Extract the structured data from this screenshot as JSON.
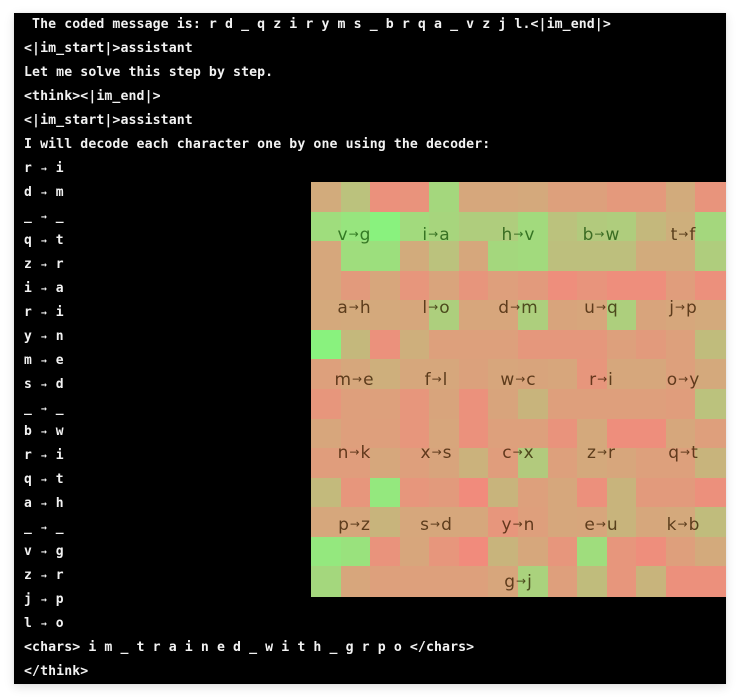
{
  "terminal": {
    "lines": [
      " The coded message is: r d _ q z i r y m s _ b r q a _ v z j l.<|im_end|>",
      "<|im_start|>assistant",
      "Let me solve this step by step.",
      "<think><|im_end|>",
      "<|im_start|>assistant",
      "I will decode each character one by one using the decoder:"
    ],
    "arrow_glyph": "→",
    "mappings": [
      {
        "from": "r",
        "to": "i"
      },
      {
        "from": "d",
        "to": "m"
      },
      {
        "from": "_",
        "to": "_"
      },
      {
        "from": "q",
        "to": "t"
      },
      {
        "from": "z",
        "to": "r"
      },
      {
        "from": "i",
        "to": "a"
      },
      {
        "from": "r",
        "to": "i"
      },
      {
        "from": "y",
        "to": "n"
      },
      {
        "from": "m",
        "to": "e"
      },
      {
        "from": "s",
        "to": "d"
      },
      {
        "from": "_",
        "to": "_"
      },
      {
        "from": "b",
        "to": "w"
      },
      {
        "from": "r",
        "to": "i"
      },
      {
        "from": "q",
        "to": "t"
      },
      {
        "from": "a",
        "to": "h"
      },
      {
        "from": "_",
        "to": "_"
      },
      {
        "from": "v",
        "to": "g"
      },
      {
        "from": "z",
        "to": "r"
      },
      {
        "from": "j",
        "to": "p"
      },
      {
        "from": "l",
        "to": "o"
      }
    ],
    "chars_line": "<chars> i m _ t r a i n e d _ w i t h _ g r p o </chars>",
    "end_line": "</think>"
  },
  "heatmap": {
    "description": "attention-style heatmap overlay, red (low) to green (high)",
    "colors": {
      "low": "#f28a7c",
      "mid": "#d2ab7c",
      "high": "#86f57e"
    },
    "grid": [
      [
        0.45,
        0.62,
        0.1,
        0.12,
        0.78,
        0.4,
        0.4,
        0.42,
        0.3,
        0.3,
        0.2,
        0.2,
        0.45,
        0.14
      ],
      [
        0.82,
        0.88,
        0.98,
        0.8,
        0.76,
        0.7,
        0.7,
        0.8,
        0.62,
        0.68,
        0.7,
        0.55,
        0.48,
        0.78
      ],
      [
        0.4,
        0.82,
        0.84,
        0.45,
        0.62,
        0.4,
        0.78,
        0.8,
        0.6,
        0.6,
        0.6,
        0.45,
        0.45,
        0.7
      ],
      [
        0.4,
        0.22,
        0.38,
        0.16,
        0.35,
        0.15,
        0.28,
        0.22,
        0.06,
        0.14,
        0.06,
        0.06,
        0.26,
        0.08
      ],
      [
        0.42,
        0.44,
        0.42,
        0.4,
        0.72,
        0.38,
        0.38,
        0.72,
        0.36,
        0.38,
        0.72,
        0.36,
        0.4,
        0.44
      ],
      [
        0.98,
        0.55,
        0.1,
        0.48,
        0.3,
        0.3,
        0.3,
        0.18,
        0.18,
        0.18,
        0.3,
        0.22,
        0.3,
        0.58
      ],
      [
        0.3,
        0.4,
        0.48,
        0.4,
        0.4,
        0.32,
        0.38,
        0.36,
        0.38,
        0.16,
        0.4,
        0.4,
        0.3,
        0.42
      ],
      [
        0.16,
        0.28,
        0.3,
        0.16,
        0.36,
        0.1,
        0.36,
        0.52,
        0.28,
        0.28,
        0.28,
        0.28,
        0.26,
        0.62
      ],
      [
        0.38,
        0.28,
        0.28,
        0.16,
        0.38,
        0.1,
        0.3,
        0.3,
        0.12,
        0.42,
        0.06,
        0.06,
        0.4,
        0.28
      ],
      [
        0.26,
        0.26,
        0.4,
        0.28,
        0.36,
        0.5,
        0.26,
        0.68,
        0.3,
        0.42,
        0.38,
        0.3,
        0.3,
        0.52
      ],
      [
        0.56,
        0.16,
        0.9,
        0.16,
        0.22,
        0.02,
        0.52,
        0.3,
        0.4,
        0.08,
        0.52,
        0.22,
        0.22,
        0.08
      ],
      [
        0.4,
        0.4,
        0.52,
        0.4,
        0.4,
        0.4,
        0.16,
        0.28,
        0.4,
        0.38,
        0.52,
        0.4,
        0.42,
        0.58
      ],
      [
        0.9,
        0.86,
        0.12,
        0.38,
        0.16,
        0.02,
        0.52,
        0.4,
        0.16,
        0.82,
        0.16,
        0.06,
        0.28,
        0.44
      ],
      [
        0.78,
        0.38,
        0.3,
        0.3,
        0.3,
        0.3,
        0.38,
        0.74,
        0.28,
        0.58,
        0.16,
        0.52,
        0.08,
        0.08
      ]
    ],
    "labels": [
      {
        "text": "v→g",
        "from": "v",
        "to": "g",
        "row": 0,
        "col": 0,
        "tone": "green"
      },
      {
        "text": "i→a",
        "from": "i",
        "to": "a",
        "row": 0,
        "col": 1,
        "tone": "green"
      },
      {
        "text": "h→v",
        "from": "h",
        "to": "v",
        "row": 0,
        "col": 2,
        "tone": "green"
      },
      {
        "text": "b→w",
        "from": "b",
        "to": "w",
        "row": 0,
        "col": 3,
        "tone": "green"
      },
      {
        "text": "t→f",
        "from": "t",
        "to": "f",
        "row": 0,
        "col": 4,
        "tone": "brown"
      },
      {
        "text": "a→h",
        "from": "a",
        "to": "h",
        "row": 1,
        "col": 0,
        "tone": "brown"
      },
      {
        "text": "l→o",
        "from": "l",
        "to": "o",
        "row": 1,
        "col": 1,
        "tone": "brown"
      },
      {
        "text": "d→m",
        "from": "d",
        "to": "m",
        "row": 1,
        "col": 2,
        "tone": "brown"
      },
      {
        "text": "u→q",
        "from": "u",
        "to": "q",
        "row": 1,
        "col": 3,
        "tone": "brown"
      },
      {
        "text": "j→p",
        "from": "j",
        "to": "p",
        "row": 1,
        "col": 4,
        "tone": "brown"
      },
      {
        "text": "m→e",
        "from": "m",
        "to": "e",
        "row": 2,
        "col": 0,
        "tone": "brown"
      },
      {
        "text": "f→l",
        "from": "f",
        "to": "l",
        "row": 2,
        "col": 1,
        "tone": "brown"
      },
      {
        "text": "w→c",
        "from": "w",
        "to": "c",
        "row": 2,
        "col": 2,
        "tone": "brown"
      },
      {
        "text": "r→i",
        "from": "r",
        "to": "i",
        "row": 2,
        "col": 3,
        "tone": "brown"
      },
      {
        "text": "o→y",
        "from": "o",
        "to": "y",
        "row": 2,
        "col": 4,
        "tone": "brown"
      },
      {
        "text": "n→k",
        "from": "n",
        "to": "k",
        "row": 3,
        "col": 0,
        "tone": "brown"
      },
      {
        "text": "x→s",
        "from": "x",
        "to": "s",
        "row": 3,
        "col": 1,
        "tone": "brown"
      },
      {
        "text": "c→x",
        "from": "c",
        "to": "x",
        "row": 3,
        "col": 2,
        "tone": "brown"
      },
      {
        "text": "z→r",
        "from": "z",
        "to": "r",
        "row": 3,
        "col": 3,
        "tone": "brown"
      },
      {
        "text": "q→t",
        "from": "q",
        "to": "t",
        "row": 3,
        "col": 4,
        "tone": "brown"
      },
      {
        "text": "p→z",
        "from": "p",
        "to": "z",
        "row": 4,
        "col": 0,
        "tone": "brown"
      },
      {
        "text": "s→d",
        "from": "s",
        "to": "d",
        "row": 4,
        "col": 1,
        "tone": "brown"
      },
      {
        "text": "y→n",
        "from": "y",
        "to": "n",
        "row": 4,
        "col": 2,
        "tone": "brown"
      },
      {
        "text": "e→u",
        "from": "e",
        "to": "u",
        "row": 4,
        "col": 3,
        "tone": "brown"
      },
      {
        "text": "k→b",
        "from": "k",
        "to": "b",
        "row": 4,
        "col": 4,
        "tone": "brown"
      },
      {
        "text": "g→j",
        "from": "g",
        "to": "j",
        "row": 5,
        "col": 2,
        "tone": "brown"
      }
    ]
  }
}
